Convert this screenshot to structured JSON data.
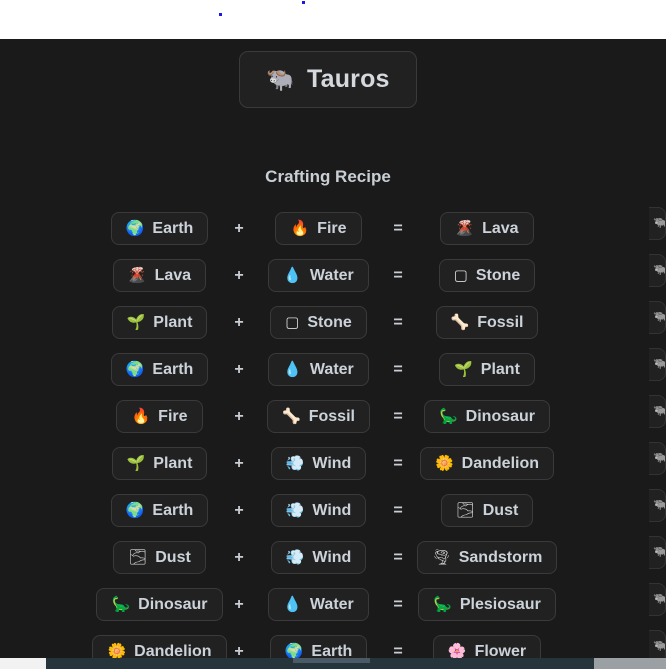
{
  "page": {
    "title_icon": "🐃",
    "title_icon_name": "water-buffalo-icon",
    "title": "Tauros",
    "section_heading": "Crafting Recipe",
    "background_color": "#1a1a1a",
    "chip_background_color": "#212121",
    "chip_border_color": "#3a3a3a",
    "text_color": "#ccd2d9",
    "operators": {
      "plus": "+",
      "equals": "="
    }
  },
  "recipes": [
    {
      "a": {
        "icon": "🌍",
        "icon_name": "earth-globe-icon",
        "label": "Earth"
      },
      "op1": "+",
      "b": {
        "icon": "🔥",
        "icon_name": "fire-icon",
        "label": "Fire"
      },
      "op2": "=",
      "result": {
        "icon": "🌋",
        "icon_name": "volcano-icon",
        "label": "Lava"
      }
    },
    {
      "a": {
        "icon": "🌋",
        "icon_name": "volcano-icon",
        "label": "Lava"
      },
      "op1": "+",
      "b": {
        "icon": "💧",
        "icon_name": "water-droplet-icon",
        "label": "Water"
      },
      "op2": "=",
      "result": {
        "icon": "▢",
        "icon_name": "stone-icon",
        "label": "Stone"
      }
    },
    {
      "a": {
        "icon": "🌱",
        "icon_name": "seedling-icon",
        "label": "Plant"
      },
      "op1": "+",
      "b": {
        "icon": "▢",
        "icon_name": "stone-icon",
        "label": "Stone"
      },
      "op2": "=",
      "result": {
        "icon": "🦴",
        "icon_name": "bone-icon",
        "label": "Fossil"
      }
    },
    {
      "a": {
        "icon": "🌍",
        "icon_name": "earth-globe-icon",
        "label": "Earth"
      },
      "op1": "+",
      "b": {
        "icon": "💧",
        "icon_name": "water-droplet-icon",
        "label": "Water"
      },
      "op2": "=",
      "result": {
        "icon": "🌱",
        "icon_name": "seedling-icon",
        "label": "Plant"
      }
    },
    {
      "a": {
        "icon": "🔥",
        "icon_name": "fire-icon",
        "label": "Fire"
      },
      "op1": "+",
      "b": {
        "icon": "🦴",
        "icon_name": "bone-icon",
        "label": "Fossil"
      },
      "op2": "=",
      "result": {
        "icon": "🦕",
        "icon_name": "dinosaur-icon",
        "label": "Dinosaur"
      }
    },
    {
      "a": {
        "icon": "🌱",
        "icon_name": "seedling-icon",
        "label": "Plant"
      },
      "op1": "+",
      "b": {
        "icon": "💨",
        "icon_name": "wind-dash-icon",
        "label": "Wind"
      },
      "op2": "=",
      "result": {
        "icon": "🌼",
        "icon_name": "blossom-icon",
        "label": "Dandelion"
      }
    },
    {
      "a": {
        "icon": "🌍",
        "icon_name": "earth-globe-icon",
        "label": "Earth"
      },
      "op1": "+",
      "b": {
        "icon": "💨",
        "icon_name": "wind-dash-icon",
        "label": "Wind"
      },
      "op2": "=",
      "result": {
        "icon": "🌫",
        "icon_name": "fog-icon",
        "label": "Dust"
      }
    },
    {
      "a": {
        "icon": "🌫",
        "icon_name": "fog-icon",
        "label": "Dust"
      },
      "op1": "+",
      "b": {
        "icon": "💨",
        "icon_name": "wind-dash-icon",
        "label": "Wind"
      },
      "op2": "=",
      "result": {
        "icon": "🌪",
        "icon_name": "tornado-icon",
        "label": "Sandstorm"
      }
    },
    {
      "a": {
        "icon": "🦕",
        "icon_name": "dinosaur-icon",
        "label": "Dinosaur"
      },
      "op1": "+",
      "b": {
        "icon": "💧",
        "icon_name": "water-droplet-icon",
        "label": "Water"
      },
      "op2": "=",
      "result": {
        "icon": "🦕",
        "icon_name": "plesiosaur-icon",
        "label": "Plesiosaur"
      }
    },
    {
      "a": {
        "icon": "🌼",
        "icon_name": "blossom-icon",
        "label": "Dandelion"
      },
      "op1": "+",
      "b": {
        "icon": "🌍",
        "icon_name": "earth-globe-icon",
        "label": "Earth"
      },
      "op2": "=",
      "result": {
        "icon": "🌸",
        "icon_name": "cherry-blossom-icon",
        "label": "Flower"
      }
    }
  ],
  "edge_pills": [
    {
      "icon": "🐃",
      "icon_name": "clipped-item-icon"
    },
    {
      "icon": "🐃",
      "icon_name": "clipped-item-icon"
    },
    {
      "icon": "🐃",
      "icon_name": "clipped-item-icon"
    },
    {
      "icon": "🐃",
      "icon_name": "clipped-item-icon"
    },
    {
      "icon": "🐃",
      "icon_name": "clipped-item-icon"
    },
    {
      "icon": "🐃",
      "icon_name": "clipped-item-icon"
    },
    {
      "icon": "🐃",
      "icon_name": "clipped-item-icon"
    },
    {
      "icon": "🐃",
      "icon_name": "clipped-item-icon"
    },
    {
      "icon": "🐃",
      "icon_name": "clipped-item-icon"
    },
    {
      "icon": "🐃",
      "icon_name": "clipped-item-icon"
    }
  ]
}
